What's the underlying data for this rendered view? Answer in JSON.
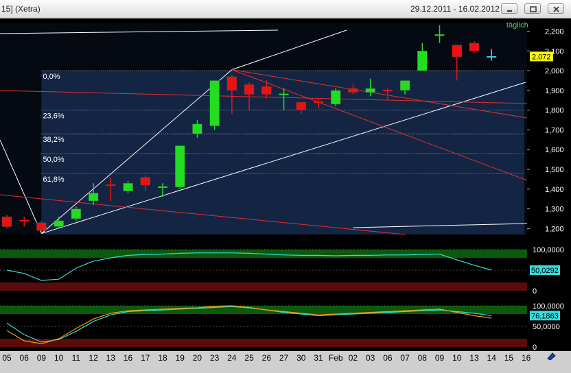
{
  "window": {
    "title": "15] (Xetra)",
    "date_range": "29.12.2011 - 16.02.2012",
    "buttons": [
      "minimize-icon",
      "restore-icon",
      "close-icon"
    ]
  },
  "colors": {
    "background": "#000000",
    "candle_up": "#22dd22",
    "candle_down": "#ee1111",
    "trend_red": "#e03030",
    "fib_fill": "#1a2f55",
    "last_price_bg": "#ffff00",
    "indicator_line": "#33dddd",
    "indicator_line2": "#ff9900",
    "zone_green": "#0b5a0b",
    "zone_red": "#5a0b0b"
  },
  "chart_data": [
    {
      "type": "candlestick",
      "period_label": "täglich",
      "x": [
        "05",
        "06",
        "09",
        "10",
        "11",
        "12",
        "13",
        "16",
        "17",
        "18",
        "19",
        "20",
        "23",
        "24",
        "25",
        "26",
        "27",
        "30",
        "31",
        "Feb",
        "02",
        "03",
        "06",
        "07",
        "08",
        "09",
        "10",
        "13",
        "14",
        "15",
        "16"
      ],
      "ohlc": [
        {
          "o": 1.26,
          "h": 1.27,
          "l": 1.2,
          "c": 1.21,
          "color": "down"
        },
        {
          "o": 1.24,
          "h": 1.26,
          "l": 1.21,
          "c": 1.23,
          "color": "down"
        },
        {
          "o": 1.23,
          "h": 1.24,
          "l": 1.18,
          "c": 1.19,
          "color": "down"
        },
        {
          "o": 1.21,
          "h": 1.26,
          "l": 1.2,
          "c": 1.24,
          "color": "up"
        },
        {
          "o": 1.25,
          "h": 1.31,
          "l": 1.24,
          "c": 1.3,
          "color": "up"
        },
        {
          "o": 1.34,
          "h": 1.43,
          "l": 1.32,
          "c": 1.38,
          "color": "up"
        },
        {
          "o": 1.42,
          "h": 1.46,
          "l": 1.34,
          "c": 1.42,
          "color": "down"
        },
        {
          "o": 1.39,
          "h": 1.44,
          "l": 1.38,
          "c": 1.43,
          "color": "up"
        },
        {
          "o": 1.46,
          "h": 1.47,
          "l": 1.39,
          "c": 1.42,
          "color": "down"
        },
        {
          "o": 1.4,
          "h": 1.43,
          "l": 1.36,
          "c": 1.41,
          "color": "up"
        },
        {
          "o": 1.41,
          "h": 1.62,
          "l": 1.4,
          "c": 1.62,
          "color": "up"
        },
        {
          "o": 1.68,
          "h": 1.75,
          "l": 1.66,
          "c": 1.73,
          "color": "up"
        },
        {
          "o": 1.72,
          "h": 1.95,
          "l": 1.7,
          "c": 1.95,
          "color": "up"
        },
        {
          "o": 1.97,
          "h": 1.98,
          "l": 1.78,
          "c": 1.9,
          "color": "down"
        },
        {
          "o": 1.93,
          "h": 1.94,
          "l": 1.8,
          "c": 1.88,
          "color": "down"
        },
        {
          "o": 1.92,
          "h": 1.95,
          "l": 1.86,
          "c": 1.88,
          "color": "down"
        },
        {
          "o": 1.87,
          "h": 1.91,
          "l": 1.8,
          "c": 1.88,
          "color": "up"
        },
        {
          "o": 1.84,
          "h": 1.84,
          "l": 1.78,
          "c": 1.8,
          "color": "down"
        },
        {
          "o": 1.84,
          "h": 1.86,
          "l": 1.81,
          "c": 1.83,
          "color": "down"
        },
        {
          "o": 1.83,
          "h": 1.91,
          "l": 1.82,
          "c": 1.9,
          "color": "up"
        },
        {
          "o": 1.91,
          "h": 1.93,
          "l": 1.88,
          "c": 1.89,
          "color": "down"
        },
        {
          "o": 1.89,
          "h": 1.96,
          "l": 1.87,
          "c": 1.91,
          "color": "up"
        },
        {
          "o": 1.9,
          "h": 1.91,
          "l": 1.85,
          "c": 1.89,
          "color": "down"
        },
        {
          "o": 1.9,
          "h": 1.95,
          "l": 1.88,
          "c": 1.95,
          "color": "up"
        },
        {
          "o": 2.0,
          "h": 2.14,
          "l": 2.0,
          "c": 2.1,
          "color": "up"
        },
        {
          "o": 2.18,
          "h": 2.23,
          "l": 2.14,
          "c": 2.18,
          "color": "up"
        },
        {
          "o": 2.13,
          "h": 2.13,
          "l": 1.95,
          "c": 2.07,
          "color": "down"
        },
        {
          "o": 2.14,
          "h": 2.15,
          "l": 2.09,
          "c": 2.1,
          "color": "down"
        },
        {
          "o": 2.07,
          "h": 2.11,
          "l": 2.05,
          "c": 2.07,
          "color": "cyan"
        },
        null,
        null
      ],
      "y_ticks": [
        "2,200",
        "2,100",
        "2,000",
        "1,900",
        "1,800",
        "1,700",
        "1,600",
        "1,500",
        "1,400",
        "1,300",
        "1,200"
      ],
      "ylim": [
        1.17,
        2.24
      ],
      "last_price": "2,072",
      "fib_levels": [
        {
          "label": "0,0%",
          "value": 2.0
        },
        {
          "label": "23,6%",
          "value": 1.8
        },
        {
          "label": "38,2%",
          "value": 1.68
        },
        {
          "label": "50,0%",
          "value": 1.58
        },
        {
          "label": "61,8%",
          "value": 1.48
        }
      ],
      "fib_range": [
        1.17,
        2.0
      ]
    },
    {
      "type": "line",
      "name": "indicator-1",
      "y_ticks": [
        "100,0000",
        "50,0000",
        "0"
      ],
      "ylim": [
        0,
        100
      ],
      "last_value": "50,0292",
      "values": [
        50,
        42,
        25,
        28,
        55,
        72,
        80,
        86,
        88,
        89,
        91,
        92,
        92,
        92,
        91,
        89,
        87,
        86,
        86,
        85,
        86,
        86,
        87,
        87,
        88,
        89,
        75,
        62,
        50,
        null,
        null
      ]
    },
    {
      "type": "line",
      "name": "indicator-2",
      "y_ticks": [
        "100,0000",
        "50,0000",
        "0"
      ],
      "ylim": [
        0,
        100
      ],
      "last_value": "76,1863",
      "series": [
        {
          "values": [
            58,
            30,
            12,
            18,
            38,
            62,
            78,
            86,
            88,
            90,
            92,
            94,
            96,
            98,
            95,
            90,
            84,
            80,
            76,
            78,
            80,
            82,
            84,
            86,
            88,
            90,
            86,
            82,
            76,
            null,
            null
          ]
        },
        {
          "values": [
            40,
            15,
            8,
            20,
            45,
            68,
            82,
            88,
            90,
            92,
            94,
            95,
            99,
            100,
            96,
            90,
            86,
            82,
            78,
            80,
            82,
            84,
            86,
            88,
            90,
            92,
            84,
            76,
            70,
            null,
            null
          ]
        }
      ]
    }
  ]
}
